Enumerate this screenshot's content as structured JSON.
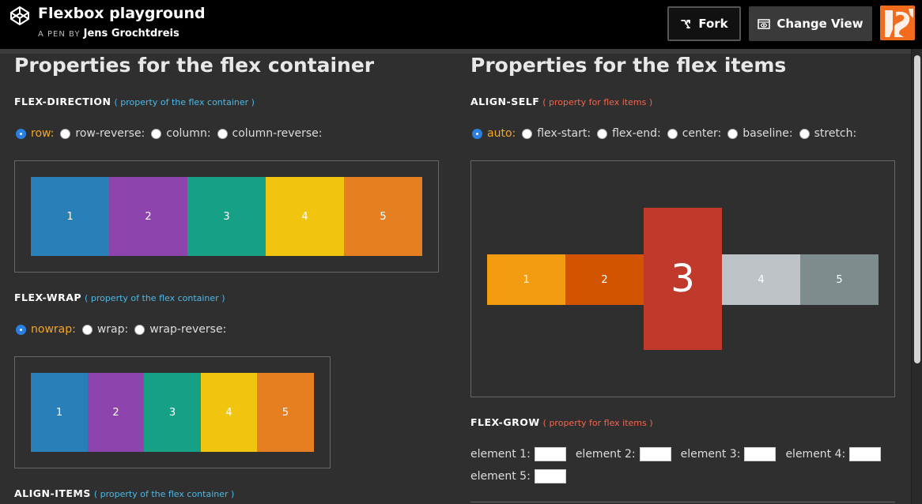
{
  "header": {
    "title": "Flexbox playground",
    "byline_prefix": "A PEN BY",
    "author": "Jens Grochtdreis",
    "fork_label": "Fork",
    "change_view_label": "Change View"
  },
  "left": {
    "heading": "Properties for the flex container",
    "flex_direction": {
      "label": "FLEX-DIRECTION",
      "hint": "( property of the flex container )",
      "options": [
        "row:",
        "row-reverse:",
        "column:",
        "column-reverse:"
      ],
      "selected": 0,
      "items": [
        "1",
        "2",
        "3",
        "4",
        "5"
      ]
    },
    "flex_wrap": {
      "label": "FLEX-WRAP",
      "hint": "( property of the flex container )",
      "options": [
        "nowrap:",
        "wrap:",
        "wrap-reverse:"
      ],
      "selected": 0,
      "items": [
        "1",
        "2",
        "3",
        "4",
        "5"
      ]
    },
    "align_items": {
      "label": "ALIGN-ITEMS",
      "hint": "( property of the flex container )"
    }
  },
  "right": {
    "heading": "Properties for the flex items",
    "align_self": {
      "label": "ALIGN-SELF",
      "hint": "( property for flex items )",
      "options": [
        "auto:",
        "flex-start:",
        "flex-end:",
        "center:",
        "baseline:",
        "stretch:"
      ],
      "selected": 0,
      "items": [
        "1",
        "2",
        "3",
        "4",
        "5"
      ]
    },
    "flex_grow": {
      "label": "FLEX-GROW",
      "hint": "( property for flex items )",
      "fields": [
        "element 1:",
        "element 2:",
        "element 3:",
        "element 4:",
        "element 5:"
      ]
    }
  },
  "colors": {
    "row_items": [
      "#2980b9",
      "#8e44ad",
      "#16a085",
      "#f1c40f",
      "#e67e22"
    ],
    "self_items": [
      "#f39c12",
      "#d35400",
      "#c0392b",
      "#bdc3c7",
      "#7f8c8d"
    ],
    "selected_option": "#f5a623",
    "hint_blue": "#4db8e6",
    "hint_red": "#f4654f"
  },
  "icons": {
    "logo": "codepen-logo-icon",
    "fork": "fork-icon",
    "change_view": "eye-window-icon"
  }
}
